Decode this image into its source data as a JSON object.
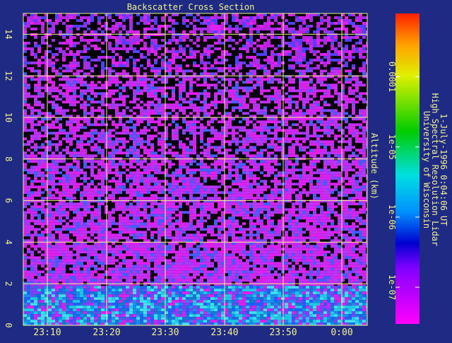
{
  "chart_data": {
    "type": "heatmap",
    "title": "Backscatter Cross Section",
    "ylabel": "Altitude (km)",
    "x_ticks": [
      "23:10",
      "23:20",
      "23:30",
      "23:40",
      "23:50",
      "0:00"
    ],
    "y_ticks": [
      "0",
      "2",
      "4",
      "6",
      "8",
      "10",
      "12",
      "14"
    ],
    "ylim": [
      0,
      15
    ],
    "grid": true,
    "colorbar": {
      "scale": "log",
      "ticks": [
        "1e-07",
        "1e-06",
        "1e-05",
        "0.0001"
      ],
      "range": [
        3e-08,
        0.0008
      ]
    },
    "layers": [
      {
        "altitude_km": [
          0,
          1.9
        ],
        "level": "high",
        "dominant": "cyan-blue"
      },
      {
        "altitude_km": [
          1.9,
          12.3
        ],
        "level": "medium",
        "dominant": "magenta"
      },
      {
        "altitude_km": [
          12.3,
          15
        ],
        "level": "low",
        "dominant": "magenta-black speckle"
      }
    ]
  },
  "sidebar": {
    "line1": "University of Wisconsin",
    "line2": "High Spectral Resolution Lidar",
    "line3": "1-July-1996  0:04:06 UT"
  },
  "colors": {
    "background": "#1f2a85",
    "grid": "#f2f28a",
    "text": "#f2f28a"
  }
}
